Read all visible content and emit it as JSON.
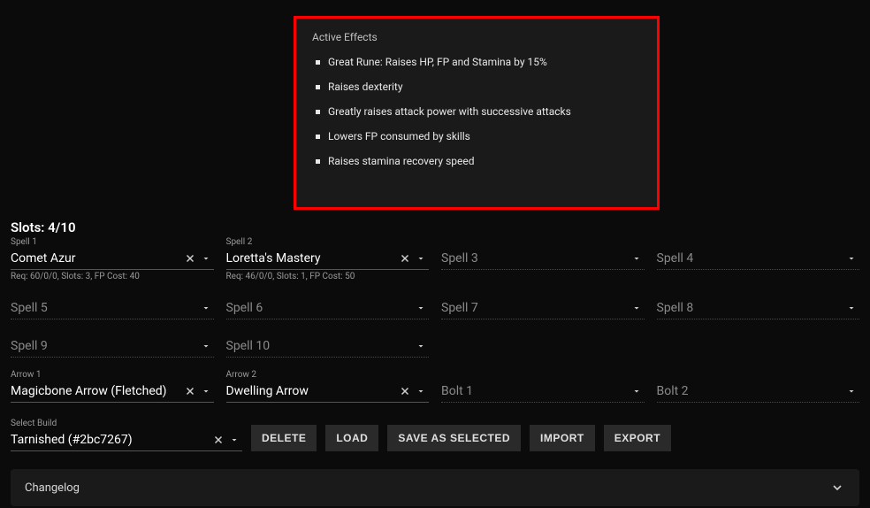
{
  "effects": {
    "title": "Active Effects",
    "items": [
      "Great Rune: Raises HP, FP and Stamina by 15%",
      "Raises dexterity",
      "Greatly raises attack power with successive attacks",
      "Lowers FP consumed by skills",
      "Raises stamina recovery speed"
    ]
  },
  "slots_header": "Slots: 4/10",
  "spells": [
    {
      "label": "Spell 1",
      "value": "Comet Azur",
      "req": "Req: 60/0/0, Slots: 3, FP Cost: 40",
      "filled": true
    },
    {
      "label": "Spell 2",
      "value": "Loretta's Mastery",
      "req": "Req: 46/0/0, Slots: 1, FP Cost: 50",
      "filled": true
    },
    {
      "label": "",
      "value": "Spell 3",
      "req": "",
      "filled": false
    },
    {
      "label": "",
      "value": "Spell 4",
      "req": "",
      "filled": false
    },
    {
      "label": "",
      "value": "Spell 5",
      "req": "",
      "filled": false
    },
    {
      "label": "",
      "value": "Spell 6",
      "req": "",
      "filled": false
    },
    {
      "label": "",
      "value": "Spell 7",
      "req": "",
      "filled": false
    },
    {
      "label": "",
      "value": "Spell 8",
      "req": "",
      "filled": false
    },
    {
      "label": "",
      "value": "Spell 9",
      "req": "",
      "filled": false
    },
    {
      "label": "",
      "value": "Spell 10",
      "req": "",
      "filled": false
    }
  ],
  "arrows": [
    {
      "label": "Arrow 1",
      "value": "Magicbone Arrow (Fletched)",
      "filled": true
    },
    {
      "label": "Arrow 2",
      "value": "Dwelling Arrow",
      "filled": true
    },
    {
      "label": "",
      "value": "Bolt 1",
      "filled": false
    },
    {
      "label": "",
      "value": "Bolt 2",
      "filled": false
    }
  ],
  "build": {
    "label": "Select Build",
    "value": "Tarnished (#2bc7267)"
  },
  "buttons": {
    "delete": "DELETE",
    "load": "LOAD",
    "save": "SAVE AS SELECTED",
    "import": "IMPORT",
    "export": "EXPORT"
  },
  "changelog": "Changelog"
}
